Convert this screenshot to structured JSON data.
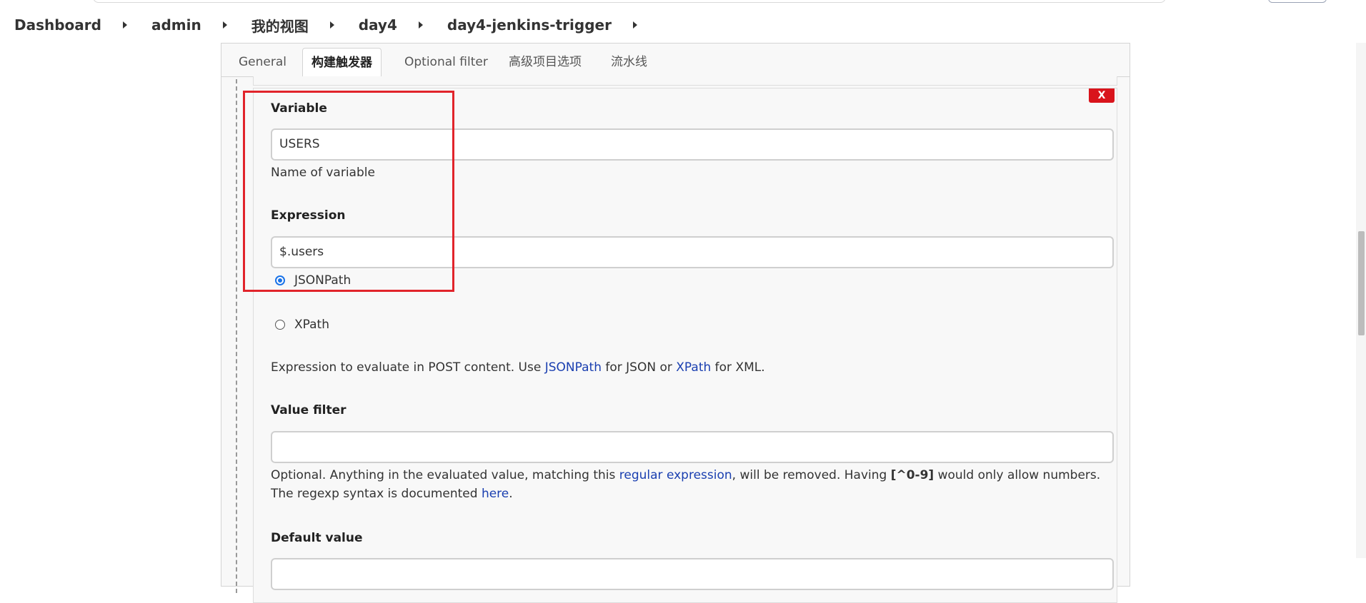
{
  "breadcrumb": [
    "Dashboard",
    "admin",
    "我的视图",
    "day4",
    "day4-jenkins-trigger"
  ],
  "tabs": [
    "General",
    "构建触发器",
    "Optional filter",
    "高级项目选项",
    "流水线"
  ],
  "active_tab": "构建触发器",
  "delete_button": "X",
  "variable": {
    "label": "Variable",
    "value": "USERS",
    "help": "Name of variable"
  },
  "expression": {
    "label": "Expression",
    "value": "$.users",
    "options": [
      "JSONPath",
      "XPath"
    ],
    "selected": "JSONPath",
    "help": {
      "part1": "Expression to evaluate in POST content. Use ",
      "link1": "JSONPath",
      "part2": " for JSON or ",
      "link2": "XPath",
      "part3": " for XML."
    }
  },
  "value_filter": {
    "label": "Value filter",
    "value": "",
    "help": {
      "part1": "Optional. Anything in the evaluated value, matching this ",
      "link1": "regular expression",
      "part2": ", will be removed. Having ",
      "code": "[^0-9]",
      "part3": " would only allow numbers. The regexp syntax is documented ",
      "link2": "here",
      "part4": "."
    }
  },
  "default_value": {
    "label": "Default value"
  },
  "colors": {
    "highlight": "#e1242b",
    "link": "#1a3fb0",
    "delete": "#d9141c"
  }
}
